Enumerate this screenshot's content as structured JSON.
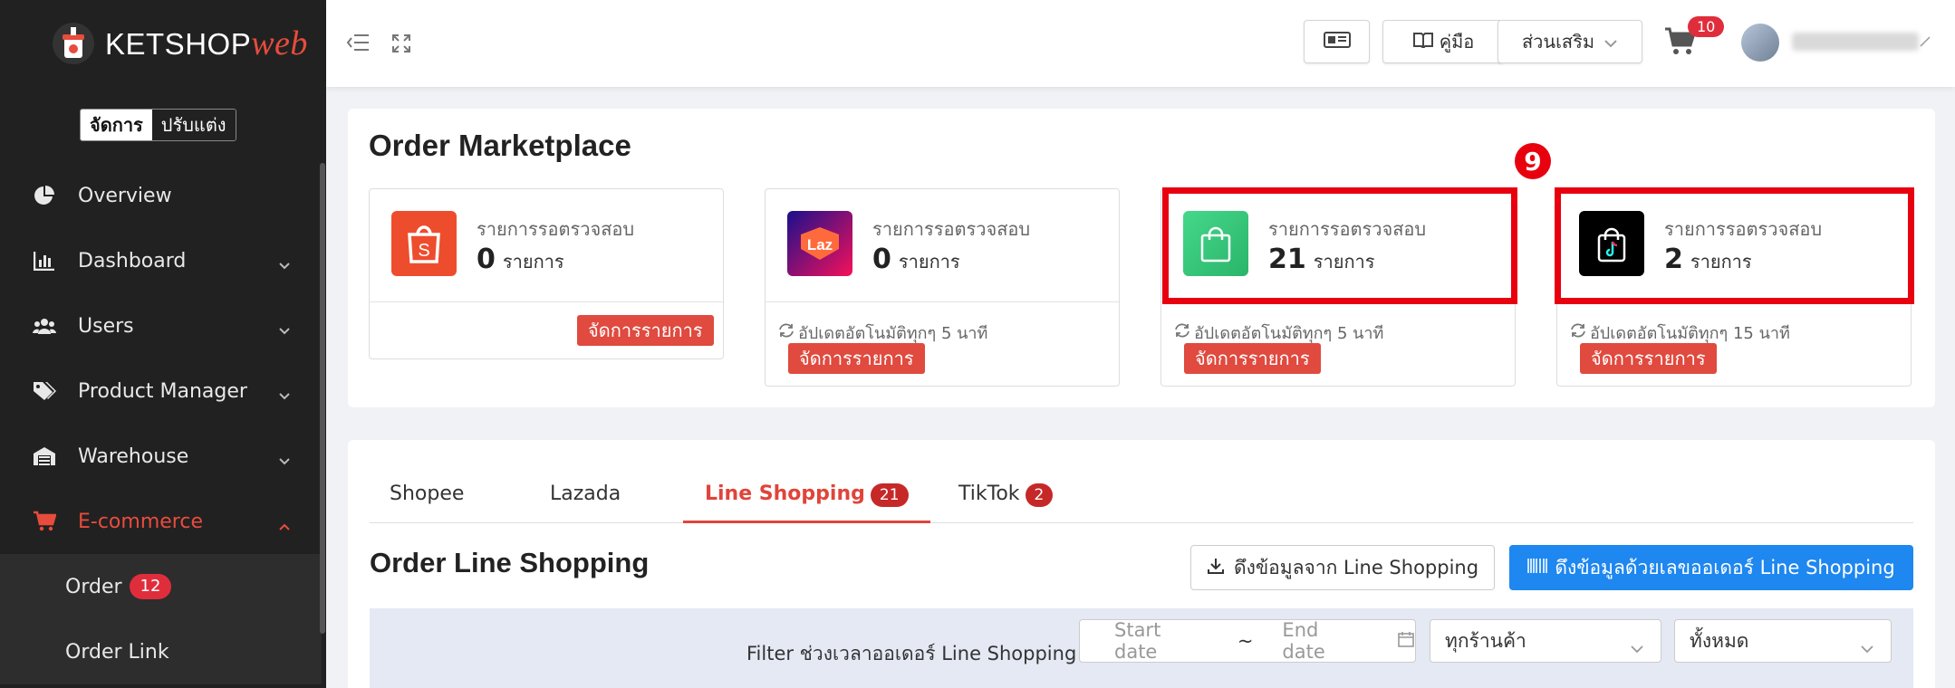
{
  "sidebar": {
    "logo_main": "KETSHOP",
    "logo_accent": "web",
    "toggle_manage": "จัดการ",
    "toggle_customize": "ปรับแต่ง",
    "items": [
      {
        "label": "Overview"
      },
      {
        "label": "Dashboard"
      },
      {
        "label": "Users"
      },
      {
        "label": "Product Manager"
      },
      {
        "label": "Warehouse"
      },
      {
        "label": "E-commerce"
      }
    ],
    "subitems": [
      {
        "label": "Order",
        "badge": "12"
      },
      {
        "label": "Order Link"
      }
    ]
  },
  "header": {
    "manual_label": "คู่มือ",
    "addons_label": "ส่วนเสริม",
    "cart_count": "10"
  },
  "marketplace": {
    "title": "Order Marketplace",
    "annotation_number": "9",
    "cards": [
      {
        "name": "Shopee",
        "label": "รายการรอตรวจสอบ",
        "count": "0",
        "unit": "รายการ",
        "update": "",
        "button": "จัดการรายการ",
        "color": "#ee4d2d"
      },
      {
        "name": "Lazada",
        "label": "รายการรอตรวจสอบ",
        "count": "0",
        "unit": "รายการ",
        "update": "อัปเดตอัตโนมัติทุกๆ 5 นาที",
        "button": "จัดการรายการ",
        "color": "#1a0f8c"
      },
      {
        "name": "Line Shopping",
        "label": "รายการรอตรวจสอบ",
        "count": "21",
        "unit": "รายการ",
        "update": "อัปเดตอัตโนมัติทุกๆ 5 นาที",
        "button": "จัดการรายการ",
        "color": "#3ac27a"
      },
      {
        "name": "TikTok",
        "label": "รายการรอตรวจสอบ",
        "count": "2",
        "unit": "รายการ",
        "update": "อัปเดตอัตโนมัติทุกๆ 15 นาที",
        "button": "จัดการรายการ",
        "color": "#000000"
      }
    ]
  },
  "orders": {
    "tabs": [
      {
        "label": "Shopee"
      },
      {
        "label": "Lazada"
      },
      {
        "label": "Line Shopping",
        "badge": "21"
      },
      {
        "label": "TikTok",
        "badge": "2"
      }
    ],
    "title": "Order Line Shopping",
    "fetch_button": "ดึงข้อมูลจาก Line Shopping",
    "fetch_by_order_button": "ดึงข้อมูลด้วยเลขออเดอร์ Line Shopping",
    "filter_label": "Filter ช่วงเวลาออเดอร์ Line Shopping",
    "start_date_placeholder": "Start date",
    "date_separator": "~",
    "end_date_placeholder": "End date",
    "shop_select": "ทุกร้านค้า",
    "status_select": "ทั้งหมด"
  }
}
